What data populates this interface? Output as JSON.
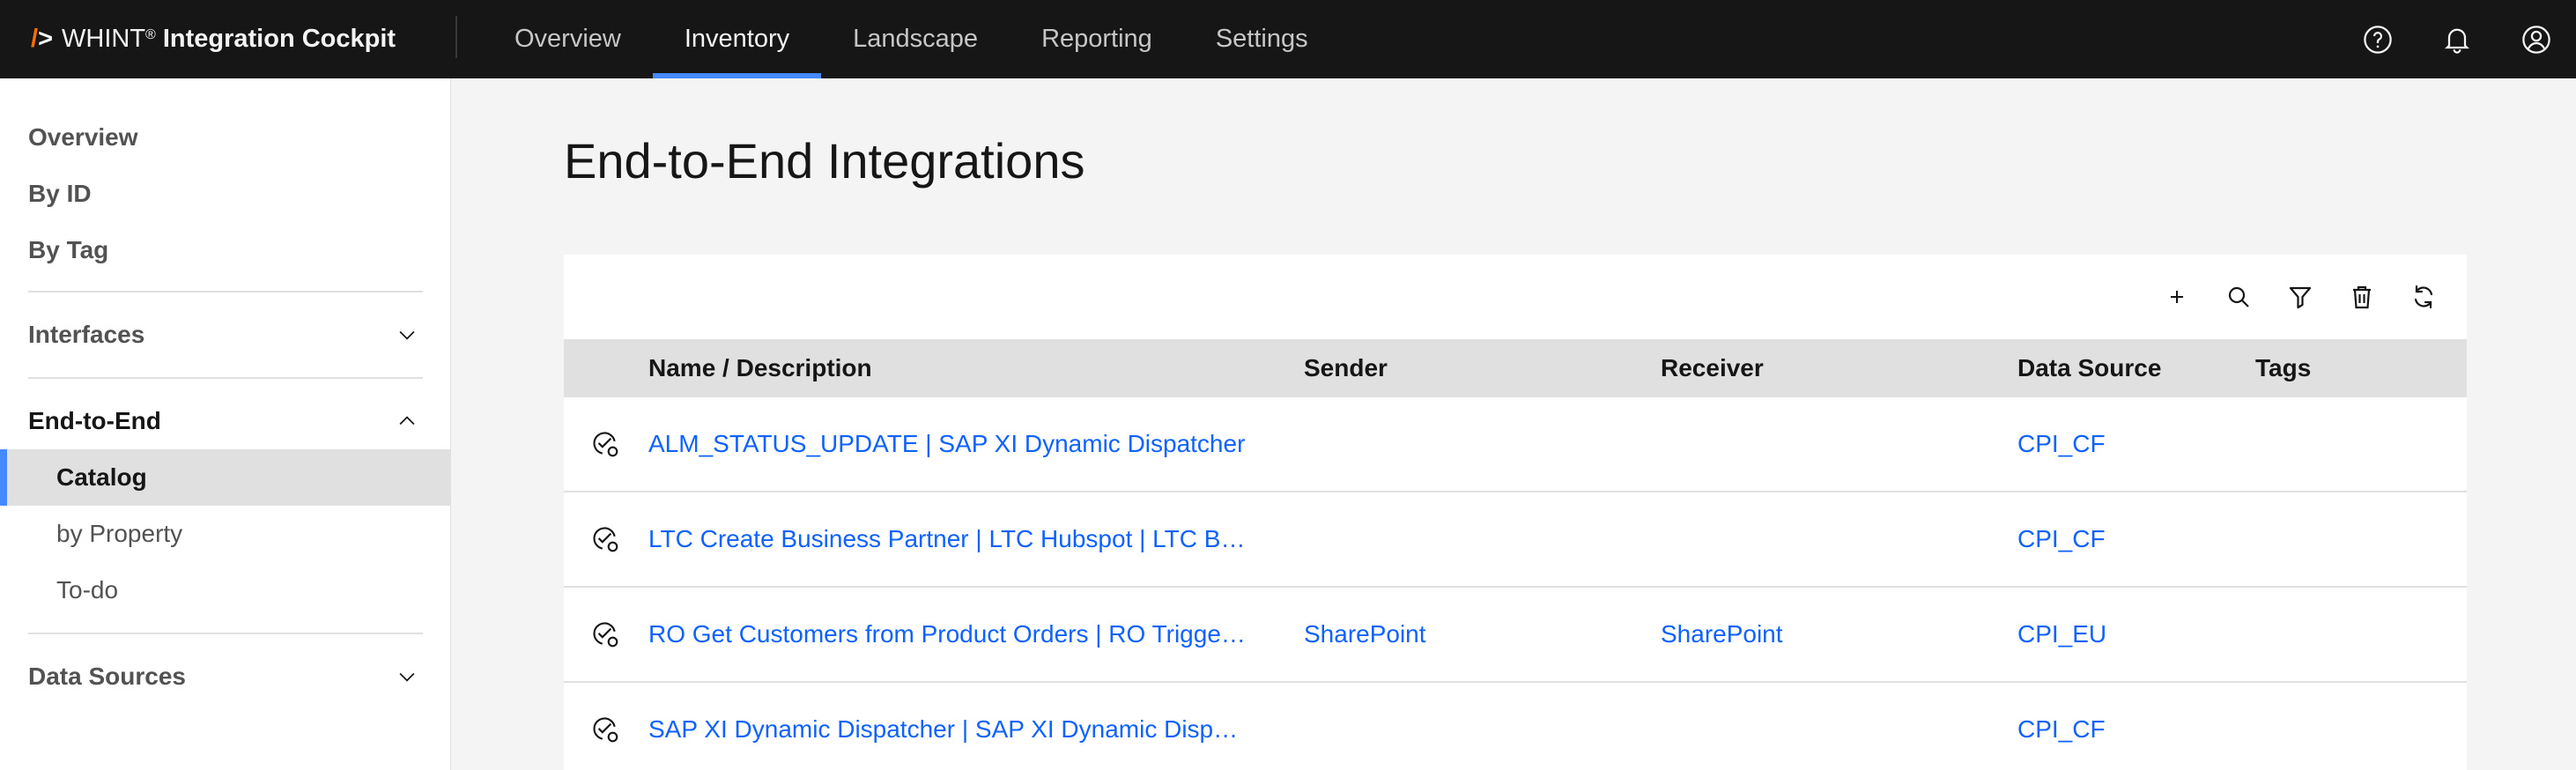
{
  "brand": {
    "mark": "/",
    "gt": ">",
    "name": "WHINT",
    "reg": "®",
    "product": "Integration Cockpit"
  },
  "topnav": [
    {
      "label": "Overview",
      "active": false
    },
    {
      "label": "Inventory",
      "active": true
    },
    {
      "label": "Landscape",
      "active": false
    },
    {
      "label": "Reporting",
      "active": false
    },
    {
      "label": "Settings",
      "active": false
    }
  ],
  "header_icons": [
    "help-icon",
    "notification-icon",
    "user-avatar-icon"
  ],
  "sidebar": {
    "overview": "Overview",
    "by_id": "By ID",
    "by_tag": "By Tag",
    "interfaces": "Interfaces",
    "end_to_end": "End-to-End",
    "catalog": "Catalog",
    "by_property": "by Property",
    "todo": "To-do",
    "data_sources": "Data Sources"
  },
  "page": {
    "title": "End-to-End Integrations"
  },
  "toolbar_icons": [
    "add-icon",
    "search-icon",
    "filter-icon",
    "delete-icon",
    "refresh-icon"
  ],
  "table": {
    "columns": [
      "Name / Description",
      "Sender",
      "Receiver",
      "Data Source",
      "Tags"
    ],
    "rows": [
      {
        "name": "ALM_STATUS_UPDATE | SAP XI Dynamic Dispatcher",
        "sender": "",
        "receiver": "",
        "source": "CPI_CF",
        "tags": ""
      },
      {
        "name": "LTC Create Business Partner | LTC Hubspot | LTC B…",
        "sender": "",
        "receiver": "",
        "source": "CPI_CF",
        "tags": ""
      },
      {
        "name": "RO Get Customers from Product Orders | RO Trigge…",
        "sender": "SharePoint",
        "receiver": "SharePoint",
        "source": "CPI_EU",
        "tags": ""
      },
      {
        "name": "SAP XI Dynamic Dispatcher | SAP XI Dynamic Disp…",
        "sender": "",
        "receiver": "",
        "source": "CPI_CF",
        "tags": ""
      }
    ]
  },
  "colors": {
    "header_bg": "#161616",
    "accent": "#4589ff",
    "link": "#0f62fe",
    "brand_orange": "#ff6f00"
  }
}
